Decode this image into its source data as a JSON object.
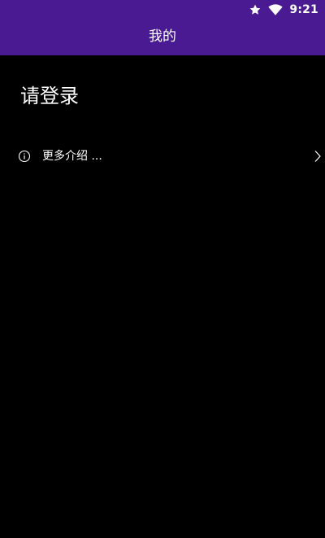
{
  "status_bar": {
    "time": "9:21",
    "icons": [
      "star-icon",
      "wifi-icon"
    ]
  },
  "app_bar": {
    "title": "我的"
  },
  "profile": {
    "login_prompt": "请登录"
  },
  "menu": {
    "items": [
      {
        "label": "更多介绍 ...",
        "icon": "info-icon",
        "trailing_icon": "chevron-right-icon"
      }
    ]
  },
  "colors": {
    "app_bar_background": "#4a1a92",
    "page_background": "#000000",
    "text": "#ffffff"
  }
}
